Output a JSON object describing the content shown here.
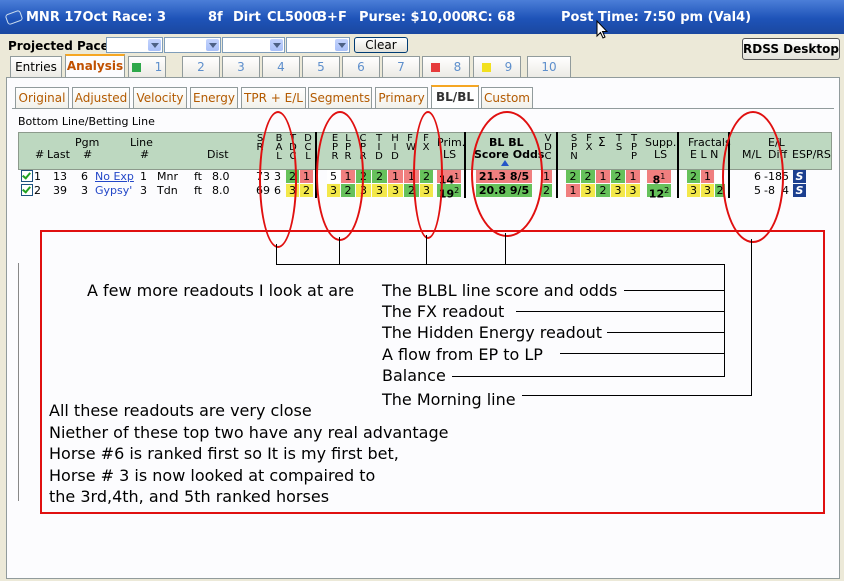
{
  "window": {
    "title": "MNR 17Oct Race: 3",
    "race_info": [
      "8f",
      "Dirt",
      "CL5000",
      "3+F",
      "Purse: $10,000",
      "RC: 68"
    ],
    "post_time": "Post Time: 7:50 pm  (Val4)"
  },
  "toolbar": {
    "projected_pace_label": "Projected Pace:",
    "clear_label": "Clear",
    "rdss_label": "RDSS Desktop"
  },
  "main_tabs": [
    {
      "label": "Entries"
    },
    {
      "label": "Analysis"
    },
    {
      "label": "1",
      "color": "#2ea84a"
    },
    {
      "label": "2"
    },
    {
      "label": "3"
    },
    {
      "label": "4"
    },
    {
      "label": "5"
    },
    {
      "label": "6"
    },
    {
      "label": "7"
    },
    {
      "label": "8",
      "color": "#e63b3b"
    },
    {
      "label": "9",
      "color": "#f2e01e"
    },
    {
      "label": "10"
    }
  ],
  "sub_tabs": [
    "Original",
    "Adjusted",
    "Velocity",
    "Energy",
    "TPR + E/L",
    "Segments",
    "Primary",
    "BL/BL",
    "Custom"
  ],
  "section_title": "Bottom Line/Betting Line",
  "columns": {
    "num": "#",
    "last": "Last",
    "pgm": "Pgm",
    "pgm_sub": "#",
    "line": "Line",
    "line_sub": "#",
    "dist": "Dist",
    "sr": "SR",
    "bal": "BAL",
    "tdc": "TDC",
    "dcl": "DCL",
    "epr": "EPR",
    "lpr": "LPR",
    "cpr": "CPR",
    "tid": "TID",
    "hid": "HID",
    "fw": "FW",
    "fx": "FX",
    "prim": "Prim.",
    "prim_sub": "LS",
    "blbl": "BL  BL",
    "blbl_sub": "Score Odds",
    "vdc": "VDC",
    "spn": "SPN",
    "fx2": "FX",
    "sigma": "Σ",
    "ts": "TS",
    "tpp": "TPP",
    "supp": "Supp.",
    "supp_sub": "LS",
    "fractals": "Fractals",
    "fractals_sub": "E  L  N",
    "el": "E/L",
    "ml": "M/L",
    "diff": "Diff",
    "esprs": "ESP/RS"
  },
  "rows": [
    {
      "num": "1",
      "last": "13",
      "pgm": "6",
      "name": "No Exp",
      "line": "1",
      "code": "Mnr",
      "dist_u": "ft",
      "dist": "8.0",
      "sr": "73",
      "bal": "3",
      "tdc": "2",
      "dcl": "1",
      "epr": "5",
      "lpr": "1",
      "cpr": "2",
      "tid": "2",
      "hid": "1",
      "fw": "1",
      "fx": "2",
      "prim": "14",
      "prim_r": "1",
      "score": "21.3",
      "odds": "8/5",
      "vdc": "1",
      "spn": "2",
      "fx2": "2",
      "sigma": "1",
      "ts": "2",
      "tpp": "1",
      "supp": "8",
      "supp_r": "1",
      "fe": "2",
      "fl": "1",
      "fn": "",
      "ml": "6",
      "diff": "-18",
      "espn": "5"
    },
    {
      "num": "2",
      "last": "39",
      "pgm": "3",
      "name": "Gypsy'",
      "line": "3",
      "code": "Tdn",
      "dist_u": "ft",
      "dist": "8.0",
      "sr": "69",
      "bal": "6",
      "tdc": "3",
      "dcl": "2",
      "epr": "3",
      "lpr": "2",
      "cpr": "3",
      "tid": "3",
      "hid": "3",
      "fw": "2",
      "fx": "3",
      "prim": "19",
      "prim_r": "2",
      "score": "20.8",
      "odds": "9/5",
      "vdc": "2",
      "spn": "1",
      "fx2": "3",
      "sigma": "2",
      "ts": "3",
      "tpp": "3",
      "supp": "12",
      "supp_r": "2",
      "fe": "3",
      "fl": "3",
      "fn": "2",
      "ml": "5",
      "diff": "-8",
      "espn": "4"
    }
  ],
  "annotation": {
    "intro": "A few more readouts I look at  are",
    "items": [
      "The BLBL line score and odds",
      "The  FX readout",
      "The Hidden Energy readout",
      "A flow from EP to LP",
      "Balance",
      "The Morning line"
    ],
    "notes": [
      "All these readouts are very close",
      "Niether of these top two have any real advantage",
      "Horse #6 is ranked first so It is my first bet,",
      "Horse # 3 is now looked at compaired to",
      "the 3rd,4th, and 5th ranked horses"
    ]
  }
}
